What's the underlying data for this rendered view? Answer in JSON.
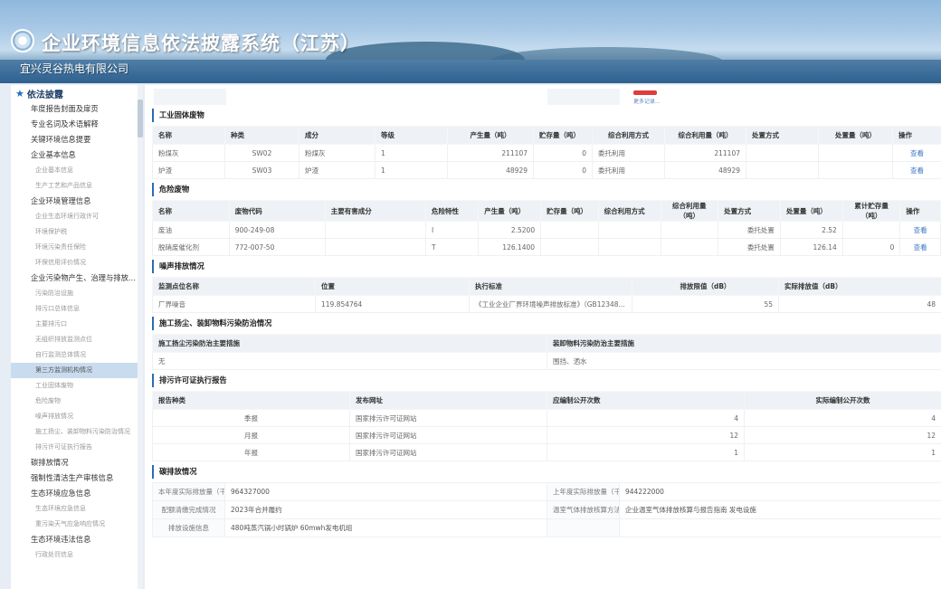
{
  "header": {
    "system_title": "企业环境信息依法披露系统（江苏）",
    "company_name": "宜兴灵谷热电有限公司"
  },
  "sidebar": {
    "root_label": "依法披露",
    "items": [
      {
        "label": "年度报告封面及扉页",
        "level": 1
      },
      {
        "label": "专业名词及术语解释",
        "level": 1
      },
      {
        "label": "关键环境信息提要",
        "level": 1
      },
      {
        "label": "企业基本信息",
        "level": 1
      },
      {
        "label": "企业基本信息",
        "level": 2
      },
      {
        "label": "生产工艺和产品信息",
        "level": 2
      },
      {
        "label": "企业环境管理信息",
        "level": 1
      },
      {
        "label": "企业生态环境行政许可",
        "level": 2
      },
      {
        "label": "环境保护税",
        "level": 2
      },
      {
        "label": "环境污染责任保险",
        "level": 2
      },
      {
        "label": "环保信用评价情况",
        "level": 2
      },
      {
        "label": "企业污染物产生、治理与排放...",
        "level": 1
      },
      {
        "label": "污染防治设施",
        "level": 2
      },
      {
        "label": "排污口总体信息",
        "level": 2
      },
      {
        "label": "主要排污口",
        "level": 2
      },
      {
        "label": "无组织排放监测点位",
        "level": 2
      },
      {
        "label": "自行监测总体情况",
        "level": 2
      },
      {
        "label": "第三方监测机构情况",
        "level": 2,
        "active": true
      },
      {
        "label": "工业固体废物",
        "level": 2
      },
      {
        "label": "危险废物",
        "level": 2
      },
      {
        "label": "噪声排放情况",
        "level": 2
      },
      {
        "label": "施工扬尘、装卸物料污染防治情况",
        "level": 2
      },
      {
        "label": "排污许可证执行报告",
        "level": 2
      },
      {
        "label": "碳排放情况",
        "level": 1
      },
      {
        "label": "强制性清洁生产审核信息",
        "level": 1
      },
      {
        "label": "生态环境应急信息",
        "level": 1
      },
      {
        "label": "生态环境应急信息",
        "level": 2
      },
      {
        "label": "重污染天气应急响应情况",
        "level": 2
      },
      {
        "label": "生态环境违法信息",
        "level": 1
      },
      {
        "label": "行政处罚信息",
        "level": 2
      }
    ]
  },
  "topstrip": {
    "more_link": "更多记录..."
  },
  "solid_waste": {
    "title": "工业固体废物",
    "headers": [
      "名称",
      "种类",
      "成分",
      "等级",
      "产生量（吨）",
      "贮存量（吨）",
      "综合利用方式",
      "综合利用量（吨）",
      "处置方式",
      "处置量（吨）",
      "操作"
    ],
    "rows": [
      [
        "粉煤灰",
        "SW02",
        "粉煤灰",
        "1",
        "211107",
        "0",
        "委托利用",
        "211107",
        "",
        "",
        "查看"
      ],
      [
        "炉渣",
        "SW03",
        "炉渣",
        "1",
        "48929",
        "0",
        "委托利用",
        "48929",
        "",
        "",
        "查看"
      ]
    ]
  },
  "hazardous_waste": {
    "title": "危险废物",
    "headers": [
      "名称",
      "废物代码",
      "主要有害成分",
      "危险特性",
      "产生量（吨）",
      "贮存量（吨）",
      "综合利用方式",
      "综合利用量（吨）",
      "处置方式",
      "处置量（吨）",
      "累计贮存量（吨）",
      "操作"
    ],
    "rows": [
      [
        "废油",
        "900-249-08",
        "",
        "I",
        "2.5200",
        "",
        "",
        "",
        "委托处置",
        "2.52",
        "",
        "查看"
      ],
      [
        "脱硝废催化剂",
        "772-007-50",
        "",
        "T",
        "126.1400",
        "",
        "",
        "",
        "委托处置",
        "126.14",
        "0",
        "查看"
      ]
    ]
  },
  "noise": {
    "title": "噪声排放情况",
    "headers": [
      "监测点位名称",
      "位置",
      "执行标准",
      "排放限值（dB）",
      "实际排放值（dB）"
    ],
    "rows": [
      [
        "厂界噪音",
        "119.854764",
        "《工业企业厂界环境噪声排放标准》（GB12348...",
        "55",
        "48"
      ]
    ]
  },
  "dust": {
    "title": "施工扬尘、装卸物料污染防治情况",
    "headers": [
      "施工扬尘污染防治主要措施",
      "装卸物料污染防治主要措施"
    ],
    "rows": [
      [
        "无",
        "围挡、洒水"
      ]
    ]
  },
  "permit_report": {
    "title": "排污许可证执行报告",
    "headers": [
      "报告种类",
      "发布网址",
      "应编制公开次数",
      "实际编制公开次数"
    ],
    "rows": [
      [
        "季报",
        "国家排污许可证网站",
        "4",
        "4"
      ],
      [
        "月报",
        "国家排污许可证网站",
        "12",
        "12"
      ],
      [
        "年报",
        "国家排污许可证网站",
        "1",
        "1"
      ]
    ]
  },
  "carbon": {
    "title": "碳排放情况",
    "actual_label": "本年度实际排放量（千克）",
    "actual_value": "964327000",
    "last_label": "上年度实际排放量（千克）",
    "last_value": "944222000",
    "quota_label": "配额清缴完成情况",
    "quota_value": "2023年合并履约",
    "method_label": "温室气体排放核算方法",
    "method_value": "企业温室气体排放核算与报告指南 发电设施",
    "facility_label": "排放设施信息",
    "facility_value": "480吨蒸汽锅小时锅炉 60mwh发电机组"
  }
}
